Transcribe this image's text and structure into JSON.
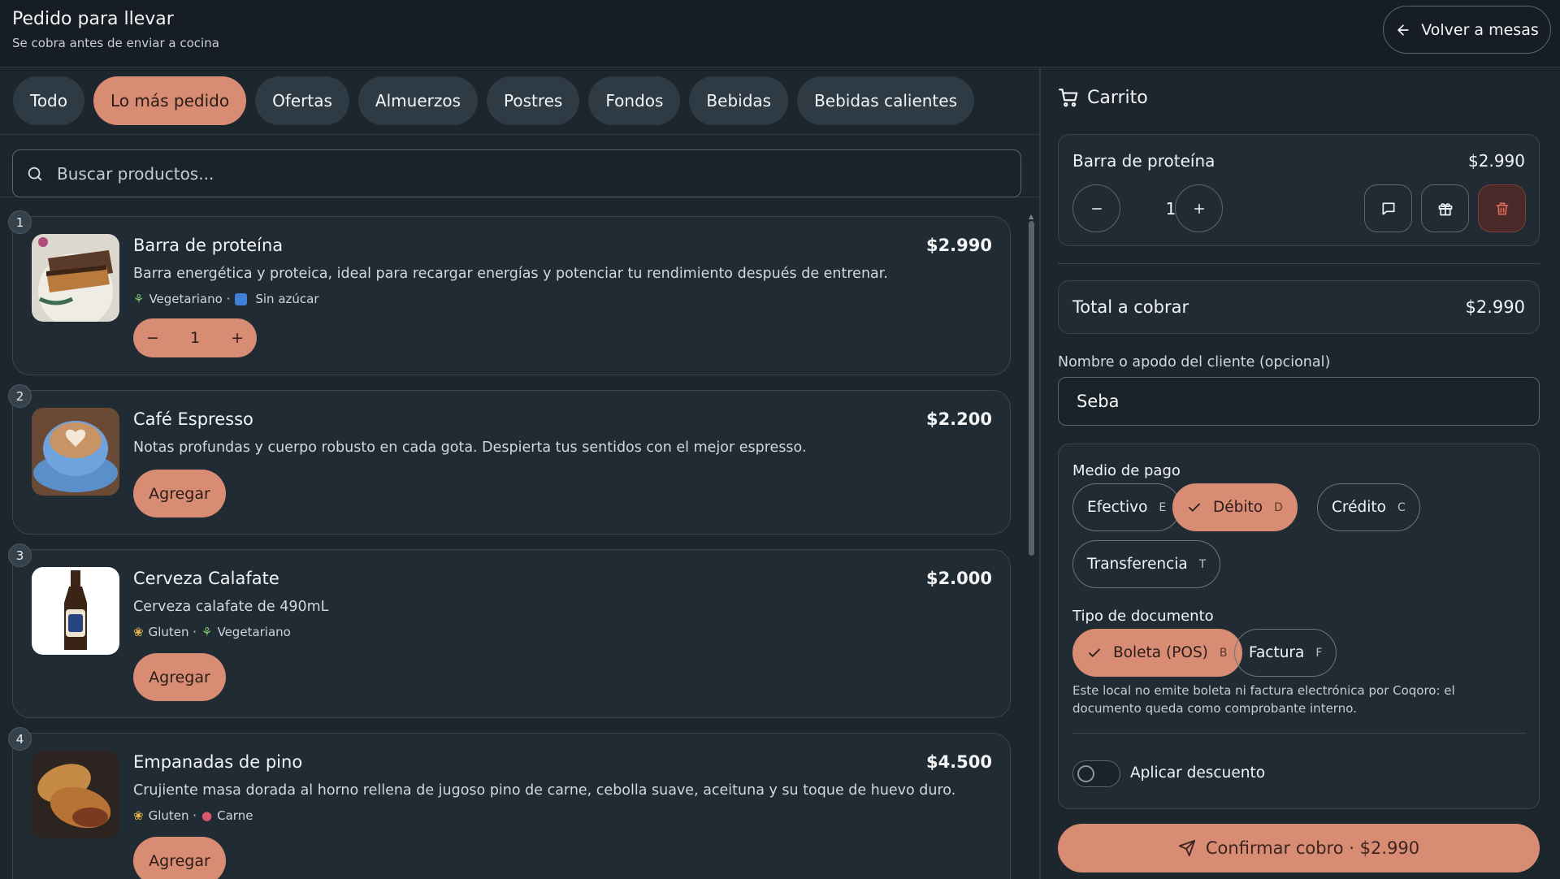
{
  "header": {
    "title": "Pedido para llevar",
    "subtitle": "Se cobra antes de enviar a cocina",
    "back_label": "Volver a mesas"
  },
  "categories": [
    "Todo",
    "Lo más pedido",
    "Ofertas",
    "Almuerzos",
    "Postres",
    "Fondos",
    "Bebidas",
    "Bebidas calientes"
  ],
  "active_category": "Lo más pedido",
  "search": {
    "placeholder": "Buscar productos..."
  },
  "products": [
    {
      "index": "1",
      "name": "Barra de proteína",
      "price": "$2.990",
      "description": "Barra energética y proteica, ideal para recargar energías y potenciar tu rendimiento después de entrenar.",
      "tags": [
        "Vegetariano ·",
        "Sin azúcar"
      ],
      "quantity": "1"
    },
    {
      "index": "2",
      "name": "Café Espresso",
      "price": "$2.200",
      "description": "Notas profundas y cuerpo robusto en cada gota. Despierta tus sentidos con el mejor espresso.",
      "add_label": "Agregar"
    },
    {
      "index": "3",
      "name": "Cerveza Calafate",
      "price": "$2.000",
      "description": "Cerveza calafate de 490mL",
      "tags": [
        "Gluten ·",
        "Vegetariano"
      ],
      "add_label": "Agregar"
    },
    {
      "index": "4",
      "name": "Empanadas de pino",
      "price": "$4.500",
      "description": "Crujiente masa dorada al horno rellena de jugoso pino de carne, cebolla suave, aceituna y su toque de huevo duro.",
      "tags": [
        "Gluten ·",
        "Carne"
      ],
      "add_label": "Agregar"
    }
  ],
  "cart": {
    "title": "Carrito",
    "item": {
      "name": "Barra de proteína",
      "price": "$2.990",
      "quantity": "1"
    },
    "total_label": "Total a cobrar",
    "total_value": "$2.990",
    "client_label": "Nombre o apodo del cliente (opcional)",
    "client_value": "Seba",
    "payment_label": "Medio de pago",
    "payment_options": [
      {
        "label": "Efectivo",
        "key": "E"
      },
      {
        "label": "Débito",
        "key": "D"
      },
      {
        "label": "Crédito",
        "key": "C"
      },
      {
        "label": "Transferencia",
        "key": "T"
      }
    ],
    "payment_selected": "Débito",
    "doc_label": "Tipo de documento",
    "doc_options": [
      {
        "label": "Boleta (POS)",
        "key": "B"
      },
      {
        "label": "Factura",
        "key": "F"
      }
    ],
    "doc_selected": "Boleta (POS)",
    "doc_note": "Este local no emite boleta ni factura electrónica por Coqoro: el documento queda como comprobante interno.",
    "discount_label": "Aplicar descuento",
    "discount_on": false,
    "confirm_label": "Confirmar cobro · $2.990"
  },
  "colors": {
    "accent": "#d98c74",
    "background": "#1d252d",
    "card": "#212b33",
    "danger_bg": "#4a2a28",
    "danger": "#e2685e"
  }
}
